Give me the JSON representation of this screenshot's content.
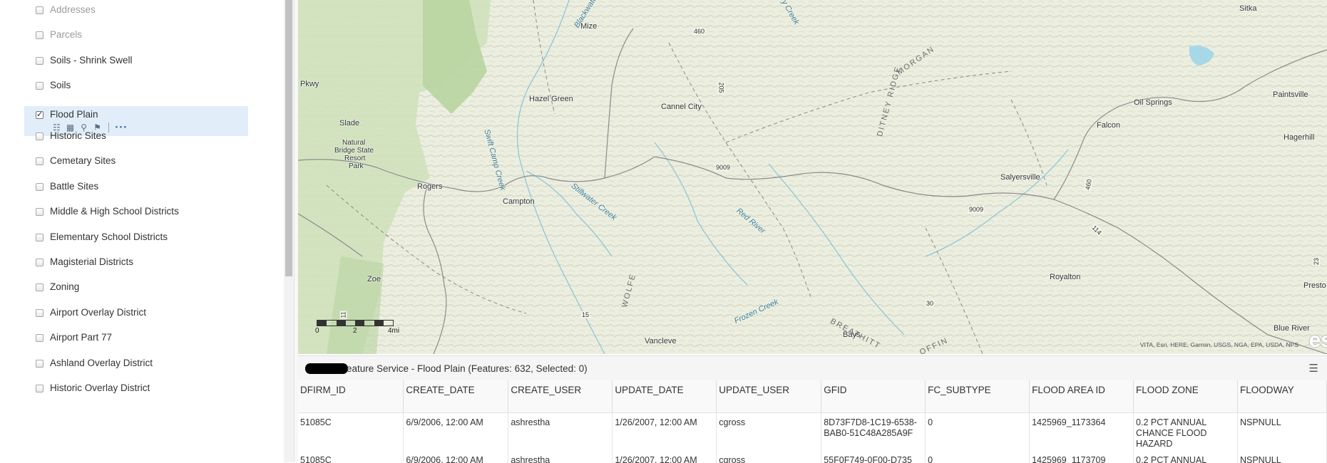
{
  "layers": [
    {
      "label": "Addresses",
      "checked": false,
      "disabled": true
    },
    {
      "label": "Parcels",
      "checked": false,
      "disabled": true
    },
    {
      "label": "Soils - Shrink Swell",
      "checked": false,
      "disabled": false
    },
    {
      "label": "Soils",
      "checked": false,
      "disabled": false
    },
    {
      "label": "Flood Plain",
      "checked": true,
      "disabled": false,
      "selected": true
    },
    {
      "label": "Historic Sites",
      "checked": false,
      "disabled": false
    },
    {
      "label": "Cemetary Sites",
      "checked": false,
      "disabled": false
    },
    {
      "label": "Battle Sites",
      "checked": false,
      "disabled": false
    },
    {
      "label": "Middle & High School Districts",
      "checked": false,
      "disabled": false
    },
    {
      "label": "Elementary School Districts",
      "checked": false,
      "disabled": false
    },
    {
      "label": "Magisterial Districts",
      "checked": false,
      "disabled": false
    },
    {
      "label": "Zoning",
      "checked": false,
      "disabled": false
    },
    {
      "label": "Airport Overlay District",
      "checked": false,
      "disabled": false
    },
    {
      "label": "Airport Part 77",
      "checked": false,
      "disabled": false
    },
    {
      "label": "Ashland Overlay District",
      "checked": false,
      "disabled": false
    },
    {
      "label": "Historic Overlay District",
      "checked": false,
      "disabled": false
    }
  ],
  "layer_tools": [
    "legend-icon",
    "table-icon",
    "query-icon",
    "filter-icon",
    "more-options-icon"
  ],
  "map": {
    "places": [
      "Mize",
      "Hazel Green",
      "Cannel City",
      "Slade",
      "Natural",
      "Bridge State",
      "Resort",
      "Park",
      "Rogers",
      "Campton",
      "Salyersville",
      "Falcon",
      "Oil Springs",
      "Paintsville",
      "Hagerhill",
      "Royalton",
      "Zoe",
      "Vancleve",
      "Bays",
      "Blue River",
      "Sitka",
      "Presto",
      "Pkwy"
    ],
    "waters": [
      "Blackwater Creek",
      "Swift Camp Creek",
      "Stillwater Creek",
      "Red River",
      "Frozen Creek",
      "y Creek"
    ],
    "regions": [
      "DITNEY RIDGE",
      "MORGAN",
      "WOLFE",
      "BREATHITT",
      "OFFIN"
    ],
    "roads": [
      "460",
      "205",
      "9009",
      "9009",
      "460",
      "114",
      "15",
      "30",
      "11",
      "23"
    ],
    "scale_labels": [
      "0",
      "2",
      "4mi"
    ],
    "attribution": "VITA, Esri, HERE, Garmin, USGS, NGA, EPA, USDA, NPS",
    "logo": "es"
  },
  "table": {
    "title": "eature Service - Flood Plain (Features: 632, Selected: 0)",
    "columns": [
      "DFIRM_ID",
      "CREATE_DATE",
      "CREATE_USER",
      "UPDATE_DATE",
      "UPDATE_USER",
      "GFID",
      "FC_SUBTYPE",
      "FLOOD AREA ID",
      "FLOOD ZONE",
      "FLOODWAY"
    ],
    "rows": [
      [
        "51085C",
        "6/9/2006, 12:00 AM",
        "ashrestha",
        "1/26/2007, 12:00 AM",
        "cgross",
        "8D73F7D8-1C19-6538-BAB0-51C48A285A9F",
        "0",
        "1425969_1173364",
        "0.2 PCT ANNUAL CHANCE FLOOD HAZARD",
        "NSPNULL"
      ],
      [
        "51085C",
        "6/9/2006, 12:00 AM",
        "ashrestha",
        "1/26/2007, 12:00 AM",
        "cgross",
        "55F0F749-0F00-D735",
        "0",
        "1425969_1173709",
        "0.2 PCT ANNUAL",
        "NSPNULL"
      ]
    ]
  }
}
